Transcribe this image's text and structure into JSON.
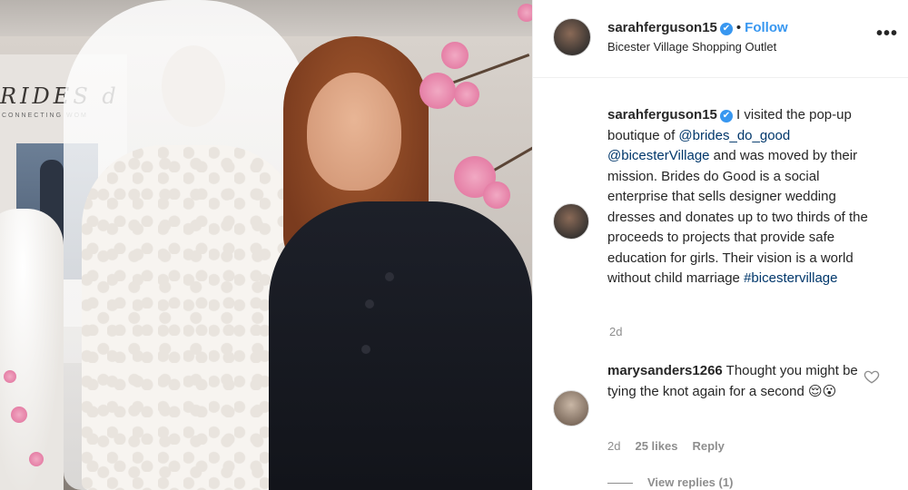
{
  "post": {
    "username": "sarahferguson15",
    "verified_badge": "✔",
    "dot": "•",
    "follow_label": "Follow",
    "location": "Bicester Village Shopping Outlet",
    "more_icon": "•••",
    "photo": {
      "sign_text": "RIDES",
      "sign_suffix": "d",
      "sign_subtext": "CONNECTING WOM"
    }
  },
  "caption": {
    "username": "sarahferguson15",
    "text_1": " I visited the pop-up boutique of ",
    "mention_1": "@brides_do_good",
    "mention_2": "@bicesterVillage",
    "text_2": " and was moved by their mission. Brides do Good is a social enterprise that sells designer wedding dresses and donates up to two thirds of the proceeds to projects that provide safe education for girls. Their vision is a world without child marriage ",
    "hashtag": "#bicestervillage",
    "time": "2d"
  },
  "comment": {
    "username": "marysanders1266",
    "text": " Thought you might be tying the knot again for a second ",
    "emoji": "😌😮",
    "time": "2d",
    "likes": "25 likes",
    "reply_label": "Reply",
    "view_replies": "View replies (1)"
  },
  "colors": {
    "link": "#3897f0",
    "mention": "#00376b",
    "meta": "#8e8e8e",
    "text": "#262626"
  }
}
